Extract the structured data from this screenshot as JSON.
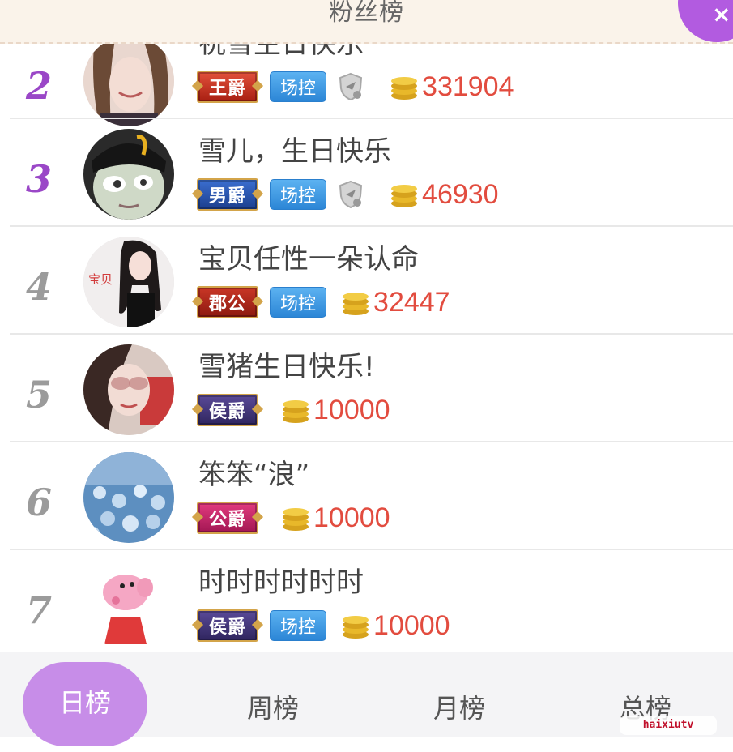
{
  "header": {
    "title": "粉丝榜",
    "close_label": "×"
  },
  "rows": [
    {
      "rank": "2",
      "name": "祝雪生日快乐",
      "title_badge": "王爵",
      "control_badge": "场控",
      "coins": "331904"
    },
    {
      "rank": "3",
      "name": "雪儿，生日快乐",
      "title_badge": "男爵",
      "control_badge": "场控",
      "coins": "46930"
    },
    {
      "rank": "4",
      "name": "宝贝任性一朵认命",
      "title_badge": "郡公",
      "control_badge": "场控",
      "coins": "32447",
      "avatar_text": "宝贝"
    },
    {
      "rank": "5",
      "name": "雪猪生日快乐!",
      "title_badge": "侯爵",
      "coins": "10000"
    },
    {
      "rank": "6",
      "name": "笨笨“浪”",
      "title_badge": "公爵",
      "coins": "10000"
    },
    {
      "rank": "7",
      "name": "时时时时时时",
      "title_badge": "侯爵",
      "control_badge": "场控",
      "coins": "10000"
    }
  ],
  "tabs": {
    "daily": "日榜",
    "weekly": "周榜",
    "monthly": "月榜",
    "total": "总榜"
  },
  "watermark": "haixiutv",
  "colors": {
    "accent": "#b25be0",
    "tab_active": "#c78de8",
    "coin_text": "#e24c3f",
    "top_rank": "#9a47c7"
  }
}
